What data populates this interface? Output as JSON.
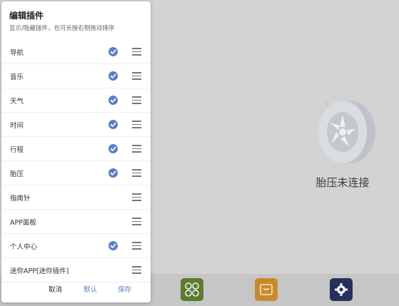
{
  "dialog": {
    "title": "编辑插件",
    "subtitle": "显示/隐藏插件，也可长按右侧拖动排序",
    "items": [
      {
        "label": "导航",
        "checked": true
      },
      {
        "label": "音乐",
        "checked": true
      },
      {
        "label": "天气",
        "checked": true
      },
      {
        "label": "时间",
        "checked": true
      },
      {
        "label": "行程",
        "checked": true
      },
      {
        "label": "胎压",
        "checked": true
      },
      {
        "label": "指南针",
        "checked": false
      },
      {
        "label": "APP面板",
        "checked": false
      },
      {
        "label": "个人中心",
        "checked": true
      },
      {
        "label": "迷你APP[迷你插件]",
        "checked": false
      }
    ],
    "buttons": {
      "cancel": "取消",
      "default": "默认",
      "save": "保存"
    }
  },
  "background": {
    "tire_status": "胎压未连接"
  },
  "dock": {
    "icons": [
      "apps-icon",
      "bag-icon",
      "settings-gear-icon"
    ]
  },
  "colors": {
    "accent": "#5b7ec2",
    "overlay": "#d3d3d3"
  }
}
